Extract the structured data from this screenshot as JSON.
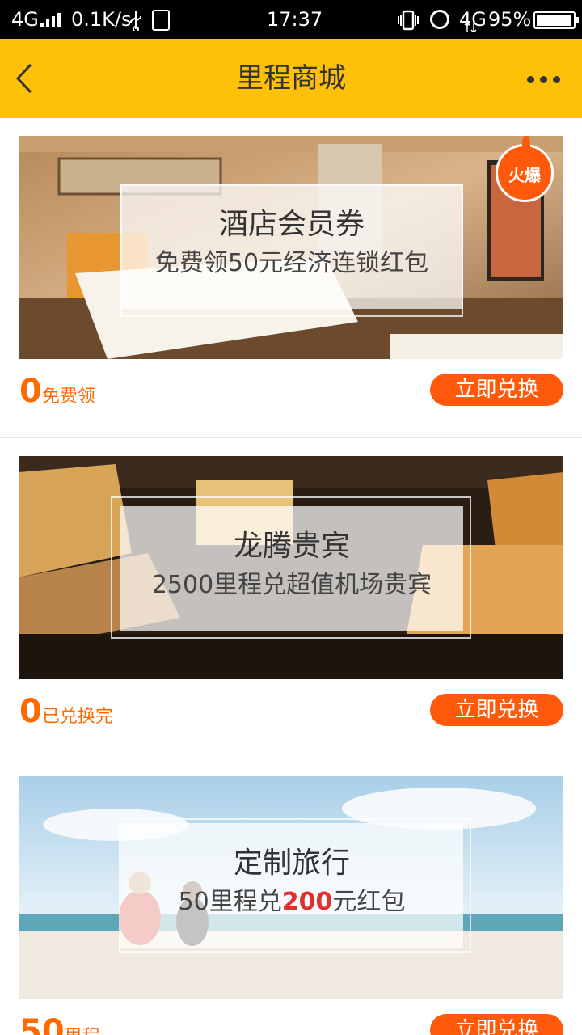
{
  "status_bar": {
    "network_label": "4G",
    "speed": "0.1K/s",
    "time": "17:37",
    "data_label": "4G",
    "battery_percent": "95%",
    "battery_level": 0.95
  },
  "nav": {
    "title": "里程商城"
  },
  "colors": {
    "nav_background": "#ffc107",
    "accent": "#ff5a0c",
    "price": "#ff6a00",
    "highlight_red": "#e0312e"
  },
  "cards": [
    {
      "banner_title": "酒店会员券",
      "banner_subtitle": "免费领50元经济连锁红包",
      "badge": "火爆",
      "price_value": "0",
      "price_unit": "免费领",
      "button_label": "立即兑换"
    },
    {
      "banner_title": "龙腾贵宾",
      "banner_subtitle": "2500里程兑超值机场贵宾",
      "price_value": "0",
      "price_unit": "已兑换完",
      "button_label": "立即兑换"
    },
    {
      "banner_title": "定制旅行",
      "banner_subtitle_pre": "50里程兑",
      "banner_subtitle_highlight": "200",
      "banner_subtitle_post": "元红包",
      "price_value": "50",
      "price_unit": "里程",
      "button_label": "立即兑换"
    }
  ]
}
